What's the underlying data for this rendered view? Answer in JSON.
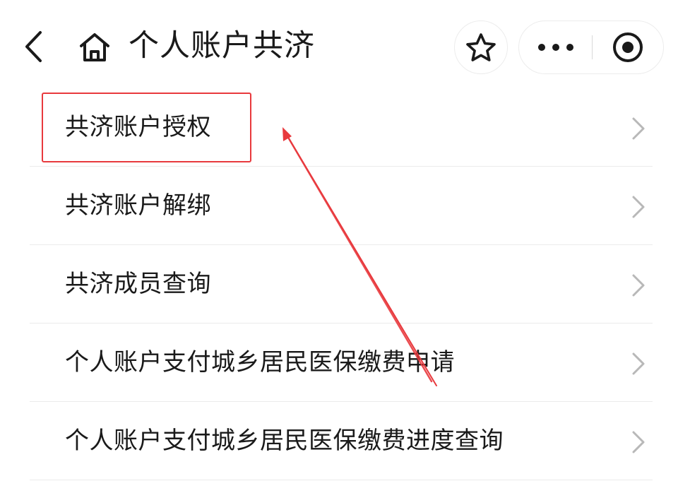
{
  "header": {
    "title": "个人账户共济",
    "back_icon": "chevron-left-icon",
    "home_icon": "home-icon",
    "favorite_icon": "star-icon",
    "more_icon": "more-dots-icon",
    "close_icon": "target-circle-icon"
  },
  "menu": {
    "items": [
      {
        "label": "共济账户授权"
      },
      {
        "label": "共济账户解绑"
      },
      {
        "label": "共济成员查询"
      },
      {
        "label": "个人账户支付城乡居民医保缴费申请"
      },
      {
        "label": "个人账户支付城乡居民医保缴费进度查询"
      }
    ]
  },
  "annotation": {
    "highlight_color": "#e8393d",
    "arrow_color": "#e8393d",
    "highlighted_item": "共济账户授权"
  },
  "colors": {
    "text": "#1a1a1a",
    "chevron": "#b8b8b8",
    "divider": "#ebebeb",
    "capsule_border": "#ececec"
  }
}
